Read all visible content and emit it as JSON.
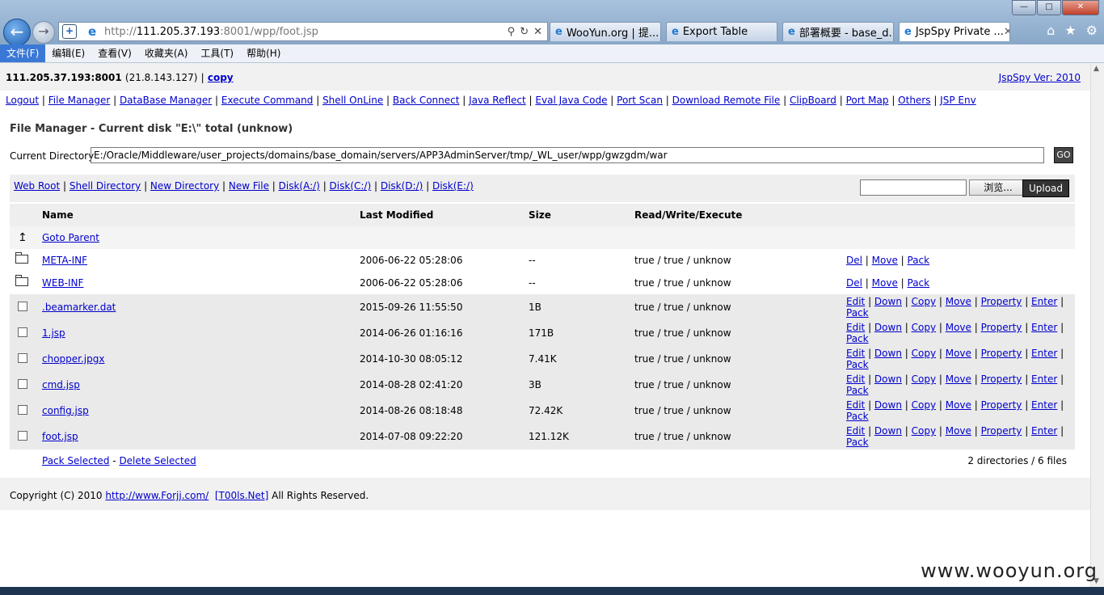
{
  "browser": {
    "url_prefix": "http://",
    "url_host": "111.205.37.193",
    "url_rest": ":8001/wpp/foot.jsp",
    "tabs": [
      {
        "title": "WooYun.org | 提..."
      },
      {
        "title": "Export Table"
      },
      {
        "title": "部署概要 - base_d..."
      },
      {
        "title": "JspSpy Private ..."
      }
    ],
    "menu": [
      "文件(F)",
      "编辑(E)",
      "查看(V)",
      "收藏夹(A)",
      "工具(T)",
      "帮助(H)"
    ]
  },
  "header": {
    "host": "111.205.37.193:8001",
    "client": "(21.8.143.127)",
    "sep": "|",
    "copy": "copy",
    "version": "JspSpy Ver: 2010"
  },
  "nav": [
    "Logout",
    "File Manager",
    "DataBase Manager",
    "Execute Command",
    "Shell OnLine",
    "Back Connect",
    "Java Reflect",
    "Eval Java Code",
    "Port Scan",
    "Download Remote File",
    "ClipBoard",
    "Port Map",
    "Others",
    "JSP Env"
  ],
  "file_manager": {
    "title": "File Manager - Current disk \"E:\\\" total (unknow)",
    "current_dir_label": "Current Directory",
    "current_dir": "E:/Oracle/Middleware/user_projects/domains/base_domain/servers/APP3AdminServer/tmp/_WL_user/wpp/gwzgdm/war",
    "go": "GO",
    "quick_links": [
      "Web Root",
      "Shell Directory",
      "New Directory",
      "New File",
      "Disk(A:/)",
      "Disk(C:/)",
      "Disk(D:/)",
      "Disk(E:/)"
    ],
    "browse": "浏览...",
    "upload": "Upload"
  },
  "table": {
    "headers": [
      "Name",
      "Last Modified",
      "Size",
      "Read/Write/Execute"
    ],
    "parent": "Goto Parent",
    "dirs": [
      {
        "name": "META-INF",
        "modified": "2006-06-22 05:28:06",
        "size": "--",
        "rwx": "true / true / unknow"
      },
      {
        "name": "WEB-INF",
        "modified": "2006-06-22 05:28:06",
        "size": "--",
        "rwx": "true / true / unknow"
      }
    ],
    "dir_actions": [
      "Del",
      "Move",
      "Pack"
    ],
    "files": [
      {
        "name": ".beamarker.dat",
        "modified": "2015-09-26 11:55:50",
        "size": "1B",
        "rwx": "true / true / unknow"
      },
      {
        "name": "1.jsp",
        "modified": "2014-06-26 01:16:16",
        "size": "171B",
        "rwx": "true / true / unknow"
      },
      {
        "name": "chopper.jpgx",
        "modified": "2014-10-30 08:05:12",
        "size": "7.41K",
        "rwx": "true / true / unknow"
      },
      {
        "name": "cmd.jsp",
        "modified": "2014-08-28 02:41:20",
        "size": "3B",
        "rwx": "true / true / unknow"
      },
      {
        "name": "config.jsp",
        "modified": "2014-08-26 08:18:48",
        "size": "72.42K",
        "rwx": "true / true / unknow"
      },
      {
        "name": "foot.jsp",
        "modified": "2014-07-08 09:22:20",
        "size": "121.12K",
        "rwx": "true / true / unknow"
      }
    ],
    "file_actions": [
      "Edit",
      "Down",
      "Copy",
      "Move",
      "Property",
      "Enter",
      "Pack"
    ],
    "pack_selected": "Pack Selected",
    "dash": "-",
    "delete_selected": "Delete Selected",
    "summary": "2 directories / 6 files"
  },
  "footer": {
    "prefix": "Copyright (C) 2010",
    "link1": "http://www.Forjj.com/",
    "link2": "[T00ls.Net]",
    "suffix": "All Rights Reserved."
  },
  "watermark": "www.wooyun.org"
}
